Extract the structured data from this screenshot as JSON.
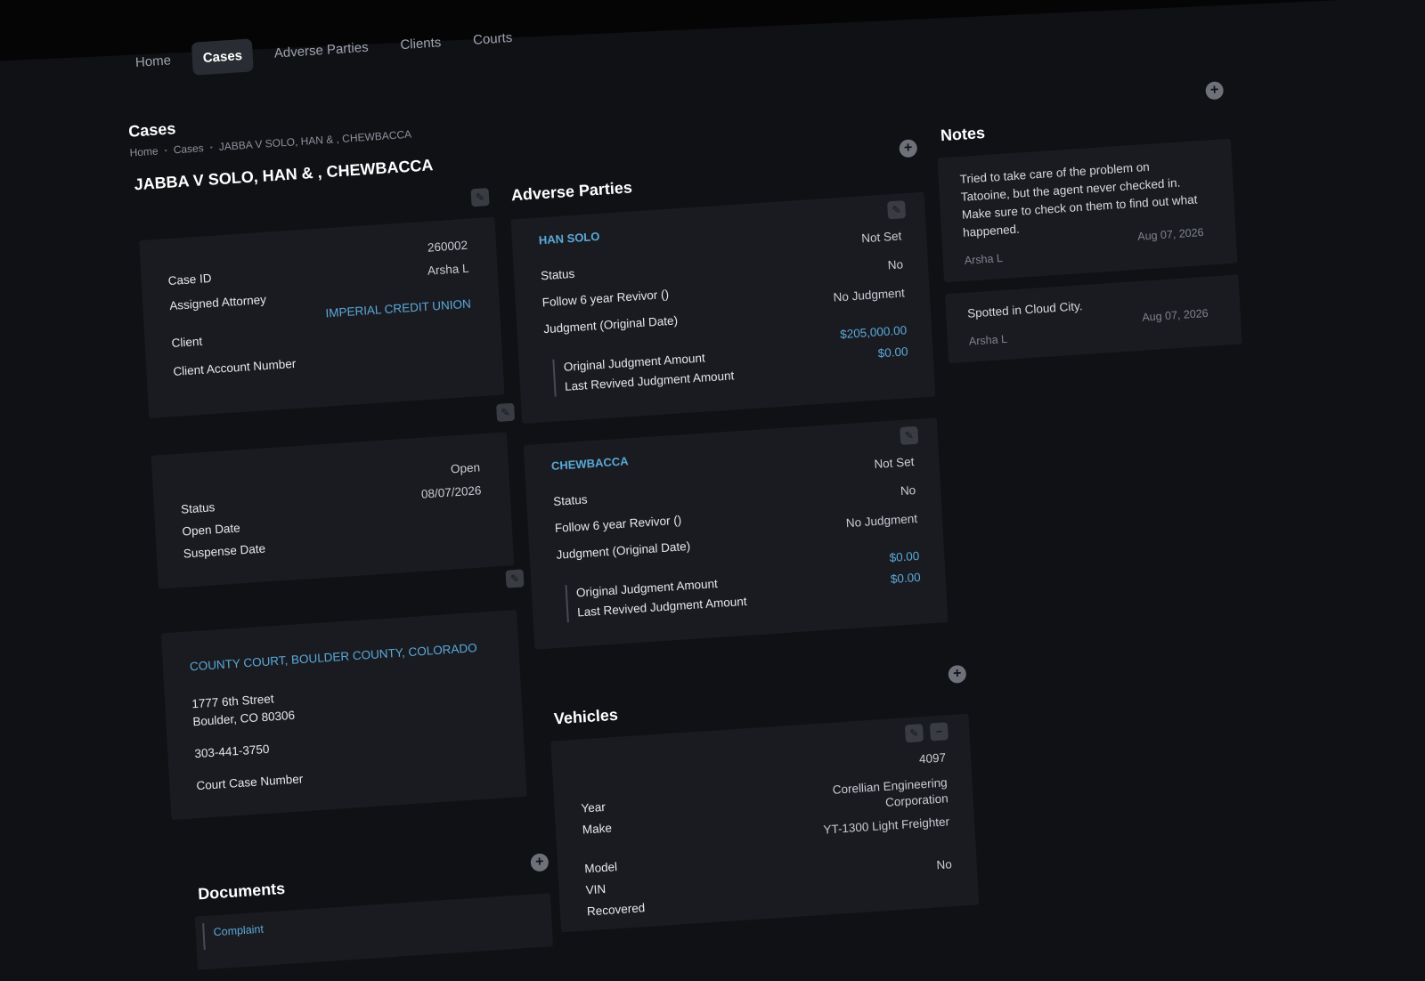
{
  "nav": {
    "items": [
      "Home",
      "Cases",
      "Adverse Parties",
      "Clients",
      "Courts"
    ]
  },
  "page": {
    "title": "Cases",
    "breadcrumb": [
      "Home",
      "Cases",
      "JABBA V SOLO, HAN & , CHEWBACCA"
    ],
    "case_title": "JABBA V SOLO, HAN & , CHEWBACCA"
  },
  "case_info": {
    "labels": [
      "Case ID",
      "Assigned Attorney",
      "Client",
      "Client Account Number"
    ],
    "case_id": "260002",
    "attorney": "Arsha L",
    "client": "IMPERIAL CREDIT UNION"
  },
  "status_info": {
    "labels": [
      "Status",
      "Open Date",
      "Suspense Date"
    ],
    "status": "Open",
    "open_date": "08/07/2026"
  },
  "court": {
    "name": "COUNTY COURT, BOULDER COUNTY, COLORADO",
    "address1": "1777 6th Street",
    "address2": "Boulder, CO 80306",
    "phone": "303-441-3750",
    "case_number_label": "Court Case Number"
  },
  "documents": {
    "heading": "Documents",
    "first_item": "Complaint"
  },
  "adverse": {
    "heading": "Adverse Parties",
    "parties": [
      {
        "name": "HAN SOLO",
        "labels": [
          "Status",
          "Follow 6 year Revivor ()",
          "Judgment (Original Date)",
          "Original Judgment Amount",
          "Last Revived Judgment Amount"
        ],
        "status": "Not Set",
        "revivor": "No",
        "judgment": "No Judgment",
        "original_amount": "$205,000.00",
        "revived_amount": "$0.00"
      },
      {
        "name": "CHEWBACCA",
        "labels": [
          "Status",
          "Follow 6 year Revivor ()",
          "Judgment (Original Date)",
          "Original Judgment Amount",
          "Last Revived Judgment Amount"
        ],
        "status": "Not Set",
        "revivor": "No",
        "judgment": "No Judgment",
        "original_amount": "$0.00",
        "revived_amount": "$0.00"
      }
    ]
  },
  "vehicles": {
    "heading": "Vehicles",
    "labels": [
      "Year",
      "Make",
      "Model",
      "VIN",
      "Recovered"
    ],
    "year": "4097",
    "make_line1": "Corellian Engineering",
    "make_line2": "Corporation",
    "model": "YT-1300 Light Freighter",
    "recovered": "No"
  },
  "notes": {
    "heading": "Notes",
    "items": [
      {
        "text_lines": [
          "Tried to take care of the problem on",
          "Tatooine, but the agent never checked in.",
          "Make sure to check on them to find out what",
          "happened."
        ],
        "author": "Arsha L",
        "date": "Aug 07, 2026"
      },
      {
        "text_lines": [
          "Spotted in Cloud City."
        ],
        "author": "Arsha L",
        "date": "Aug 07, 2026"
      }
    ]
  },
  "icons": {
    "edit": "pencil-icon",
    "add": "plus-icon",
    "remove": "minus-icon"
  }
}
